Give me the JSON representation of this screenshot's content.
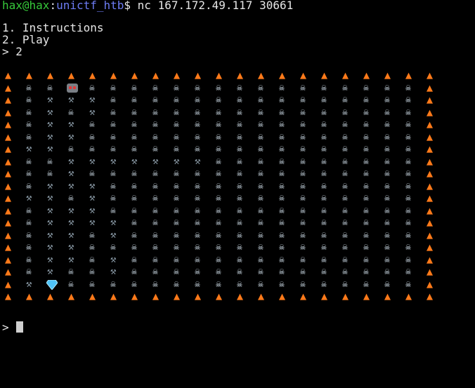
{
  "terminal": {
    "prompt": {
      "user": "hax@hax",
      "sep": ":",
      "path": "unictf_htb",
      "command": "$ nc 167.172.49.117 30661"
    },
    "menu": [
      "1. Instructions",
      "2. Play",
      "> 2"
    ],
    "input_prompt": ">",
    "colors": {
      "background": "#000000",
      "user": "#36c93a",
      "path": "#6d7cf3",
      "text": "#e6e6e6"
    },
    "board": {
      "legend": {
        "F": "fire-icon",
        "S": "skull-crossbones-icon",
        "W": "wrench-icon",
        "R": "robot-icon",
        "D": "diamond-icon"
      },
      "rows": [
        "FFFFFFFFFFFFFFFFFFFFF",
        "FSSRSSSSSSSSSSSSSSSSF",
        "FSWWWSSSSSSSSSSSSSSSF",
        "FSWSWSSSSSSSSSSSSSSSF",
        "FSWWSSSSSSSSSSSSSSSSF",
        "FSWWSSSSSSSSSSSSSSSSF",
        "FWWSSSSSSSSSSSSSSSSSF",
        "FSSWWWWWWWSSSSSSSSSSF",
        "FSSWSSSSSSSSSSSSSSSSF",
        "FSWWWSSSSSSSSSSSSSSSF",
        "FWWSWSSSSSSSSSSSSSSSF",
        "FSWWWSSSSSSSSSSSSSSSF",
        "FSWWWWSSSSSSSSSSSSSSF",
        "FSWWSWSSSSSSSSSSSSSSF",
        "FSWWSSSSSSSSSSSSSSSSF",
        "FSWWSWSSSSSSSSSSSSSSF",
        "FSWSSWSSSSSSSSSSSSSSF",
        "FWDSSSSSSSSSSSSSSSSSF",
        "FFFFFFFFFFFFFFFFFFFFF"
      ]
    }
  }
}
